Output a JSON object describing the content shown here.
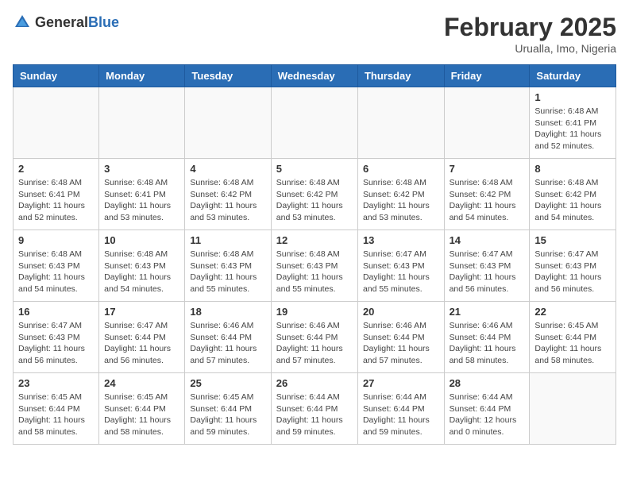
{
  "header": {
    "logo_general": "General",
    "logo_blue": "Blue",
    "month_title": "February 2025",
    "location": "Urualla, Imo, Nigeria"
  },
  "weekdays": [
    "Sunday",
    "Monday",
    "Tuesday",
    "Wednesday",
    "Thursday",
    "Friday",
    "Saturday"
  ],
  "weeks": [
    [
      {
        "day": "",
        "info": ""
      },
      {
        "day": "",
        "info": ""
      },
      {
        "day": "",
        "info": ""
      },
      {
        "day": "",
        "info": ""
      },
      {
        "day": "",
        "info": ""
      },
      {
        "day": "",
        "info": ""
      },
      {
        "day": "1",
        "info": "Sunrise: 6:48 AM\nSunset: 6:41 PM\nDaylight: 11 hours\nand 52 minutes."
      }
    ],
    [
      {
        "day": "2",
        "info": "Sunrise: 6:48 AM\nSunset: 6:41 PM\nDaylight: 11 hours\nand 52 minutes."
      },
      {
        "day": "3",
        "info": "Sunrise: 6:48 AM\nSunset: 6:41 PM\nDaylight: 11 hours\nand 53 minutes."
      },
      {
        "day": "4",
        "info": "Sunrise: 6:48 AM\nSunset: 6:42 PM\nDaylight: 11 hours\nand 53 minutes."
      },
      {
        "day": "5",
        "info": "Sunrise: 6:48 AM\nSunset: 6:42 PM\nDaylight: 11 hours\nand 53 minutes."
      },
      {
        "day": "6",
        "info": "Sunrise: 6:48 AM\nSunset: 6:42 PM\nDaylight: 11 hours\nand 53 minutes."
      },
      {
        "day": "7",
        "info": "Sunrise: 6:48 AM\nSunset: 6:42 PM\nDaylight: 11 hours\nand 54 minutes."
      },
      {
        "day": "8",
        "info": "Sunrise: 6:48 AM\nSunset: 6:42 PM\nDaylight: 11 hours\nand 54 minutes."
      }
    ],
    [
      {
        "day": "9",
        "info": "Sunrise: 6:48 AM\nSunset: 6:43 PM\nDaylight: 11 hours\nand 54 minutes."
      },
      {
        "day": "10",
        "info": "Sunrise: 6:48 AM\nSunset: 6:43 PM\nDaylight: 11 hours\nand 54 minutes."
      },
      {
        "day": "11",
        "info": "Sunrise: 6:48 AM\nSunset: 6:43 PM\nDaylight: 11 hours\nand 55 minutes."
      },
      {
        "day": "12",
        "info": "Sunrise: 6:48 AM\nSunset: 6:43 PM\nDaylight: 11 hours\nand 55 minutes."
      },
      {
        "day": "13",
        "info": "Sunrise: 6:47 AM\nSunset: 6:43 PM\nDaylight: 11 hours\nand 55 minutes."
      },
      {
        "day": "14",
        "info": "Sunrise: 6:47 AM\nSunset: 6:43 PM\nDaylight: 11 hours\nand 56 minutes."
      },
      {
        "day": "15",
        "info": "Sunrise: 6:47 AM\nSunset: 6:43 PM\nDaylight: 11 hours\nand 56 minutes."
      }
    ],
    [
      {
        "day": "16",
        "info": "Sunrise: 6:47 AM\nSunset: 6:43 PM\nDaylight: 11 hours\nand 56 minutes."
      },
      {
        "day": "17",
        "info": "Sunrise: 6:47 AM\nSunset: 6:44 PM\nDaylight: 11 hours\nand 56 minutes."
      },
      {
        "day": "18",
        "info": "Sunrise: 6:46 AM\nSunset: 6:44 PM\nDaylight: 11 hours\nand 57 minutes."
      },
      {
        "day": "19",
        "info": "Sunrise: 6:46 AM\nSunset: 6:44 PM\nDaylight: 11 hours\nand 57 minutes."
      },
      {
        "day": "20",
        "info": "Sunrise: 6:46 AM\nSunset: 6:44 PM\nDaylight: 11 hours\nand 57 minutes."
      },
      {
        "day": "21",
        "info": "Sunrise: 6:46 AM\nSunset: 6:44 PM\nDaylight: 11 hours\nand 58 minutes."
      },
      {
        "day": "22",
        "info": "Sunrise: 6:45 AM\nSunset: 6:44 PM\nDaylight: 11 hours\nand 58 minutes."
      }
    ],
    [
      {
        "day": "23",
        "info": "Sunrise: 6:45 AM\nSunset: 6:44 PM\nDaylight: 11 hours\nand 58 minutes."
      },
      {
        "day": "24",
        "info": "Sunrise: 6:45 AM\nSunset: 6:44 PM\nDaylight: 11 hours\nand 58 minutes."
      },
      {
        "day": "25",
        "info": "Sunrise: 6:45 AM\nSunset: 6:44 PM\nDaylight: 11 hours\nand 59 minutes."
      },
      {
        "day": "26",
        "info": "Sunrise: 6:44 AM\nSunset: 6:44 PM\nDaylight: 11 hours\nand 59 minutes."
      },
      {
        "day": "27",
        "info": "Sunrise: 6:44 AM\nSunset: 6:44 PM\nDaylight: 11 hours\nand 59 minutes."
      },
      {
        "day": "28",
        "info": "Sunrise: 6:44 AM\nSunset: 6:44 PM\nDaylight: 12 hours\nand 0 minutes."
      },
      {
        "day": "",
        "info": ""
      }
    ]
  ]
}
